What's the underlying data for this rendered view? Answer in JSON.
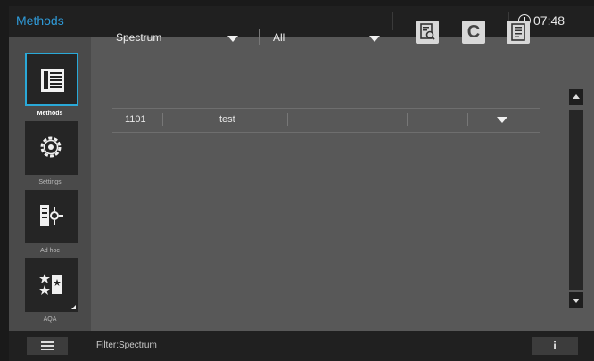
{
  "header": {
    "title": "Methods",
    "time": "07:48"
  },
  "sidebar": {
    "items": [
      {
        "label": "Methods",
        "icon": "methods-list-icon",
        "active": true
      },
      {
        "label": "Settings",
        "icon": "gear-icon",
        "active": false
      },
      {
        "label": "Ad hoc",
        "icon": "adhoc-icon",
        "active": false
      },
      {
        "label": "AQA",
        "icon": "aqa-stars-icon",
        "active": false
      }
    ]
  },
  "filters": {
    "type": "Spectrum",
    "scope": "All"
  },
  "toolbar": {
    "c_label": "C"
  },
  "table": {
    "rows": [
      {
        "id": "1101",
        "name": "test"
      }
    ]
  },
  "footer": {
    "status": "Filter:Spectrum",
    "info_label": "i"
  },
  "colors": {
    "accent": "#2aa9d8",
    "title": "#2f9ad8",
    "background": "#585858"
  }
}
